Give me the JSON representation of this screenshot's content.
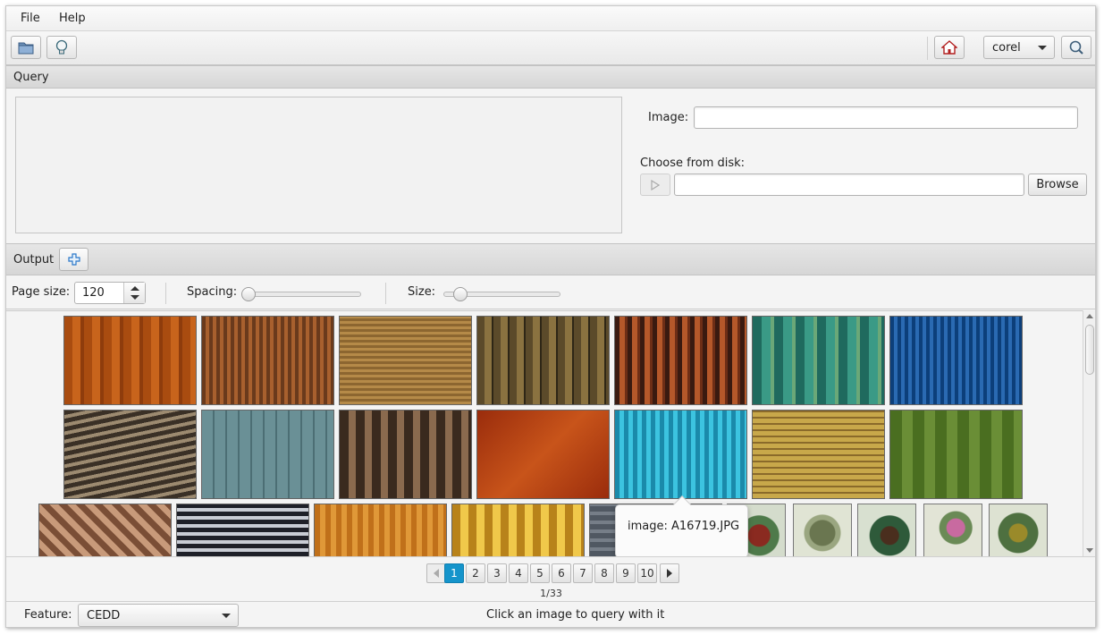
{
  "menu": {
    "file": "File",
    "help": "Help"
  },
  "toolbar": {
    "open_icon": "folder-icon",
    "idea_icon": "lightbulb-icon",
    "home_icon": "home-icon",
    "dataset": "corel",
    "search_icon": "search-icon"
  },
  "query": {
    "header": "Query",
    "image_label": "Image:",
    "image_value": "",
    "choose_label": "Choose from disk:",
    "path_value": "",
    "browse": "Browse"
  },
  "output": {
    "header": "Output",
    "add_icon": "plus-icon",
    "page_size_label": "Page size:",
    "page_size": "120",
    "spacing_label": "Spacing:",
    "spacing_level": 0.0,
    "size_label": "Size:",
    "size_level": 0.1
  },
  "tooltip": {
    "text": "image: A16719.JPG"
  },
  "pagination": {
    "pages": [
      "1",
      "2",
      "3",
      "4",
      "5",
      "6",
      "7",
      "8",
      "9",
      "10"
    ],
    "current": "1",
    "info": "1/33"
  },
  "status": {
    "feature_label": "Feature:",
    "feature": "CEDD",
    "hint": "Click an image to query with it"
  },
  "colors": {
    "accent": "#1594cb"
  }
}
